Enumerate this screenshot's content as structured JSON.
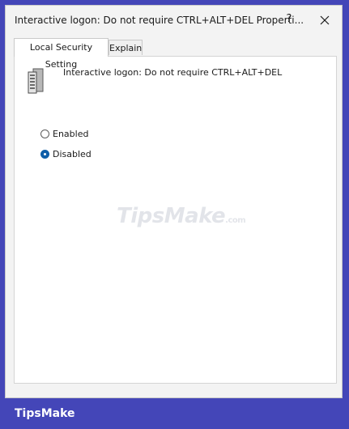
{
  "window": {
    "title": "Interactive logon: Do not require CTRL+ALT+DEL Properti...",
    "help_label": "?"
  },
  "tabs": [
    {
      "label": "Local Security Setting",
      "selected": true
    },
    {
      "label": "Explain",
      "selected": false
    }
  ],
  "policy": {
    "name": "Interactive logon: Do not require CTRL+ALT+DEL",
    "icon": "server-policy-icon"
  },
  "options": [
    {
      "label": "Enabled",
      "checked": false
    },
    {
      "label": "Disabled",
      "checked": true
    }
  ],
  "watermark": {
    "main": "TipsMake",
    "suffix": ".com"
  },
  "footer": {
    "brand": "TipsMake"
  },
  "colors": {
    "frame": "#4446b8",
    "accent": "#0f5ea8",
    "dialog_bg": "#f3f3f3",
    "panel_bg": "#ffffff"
  }
}
